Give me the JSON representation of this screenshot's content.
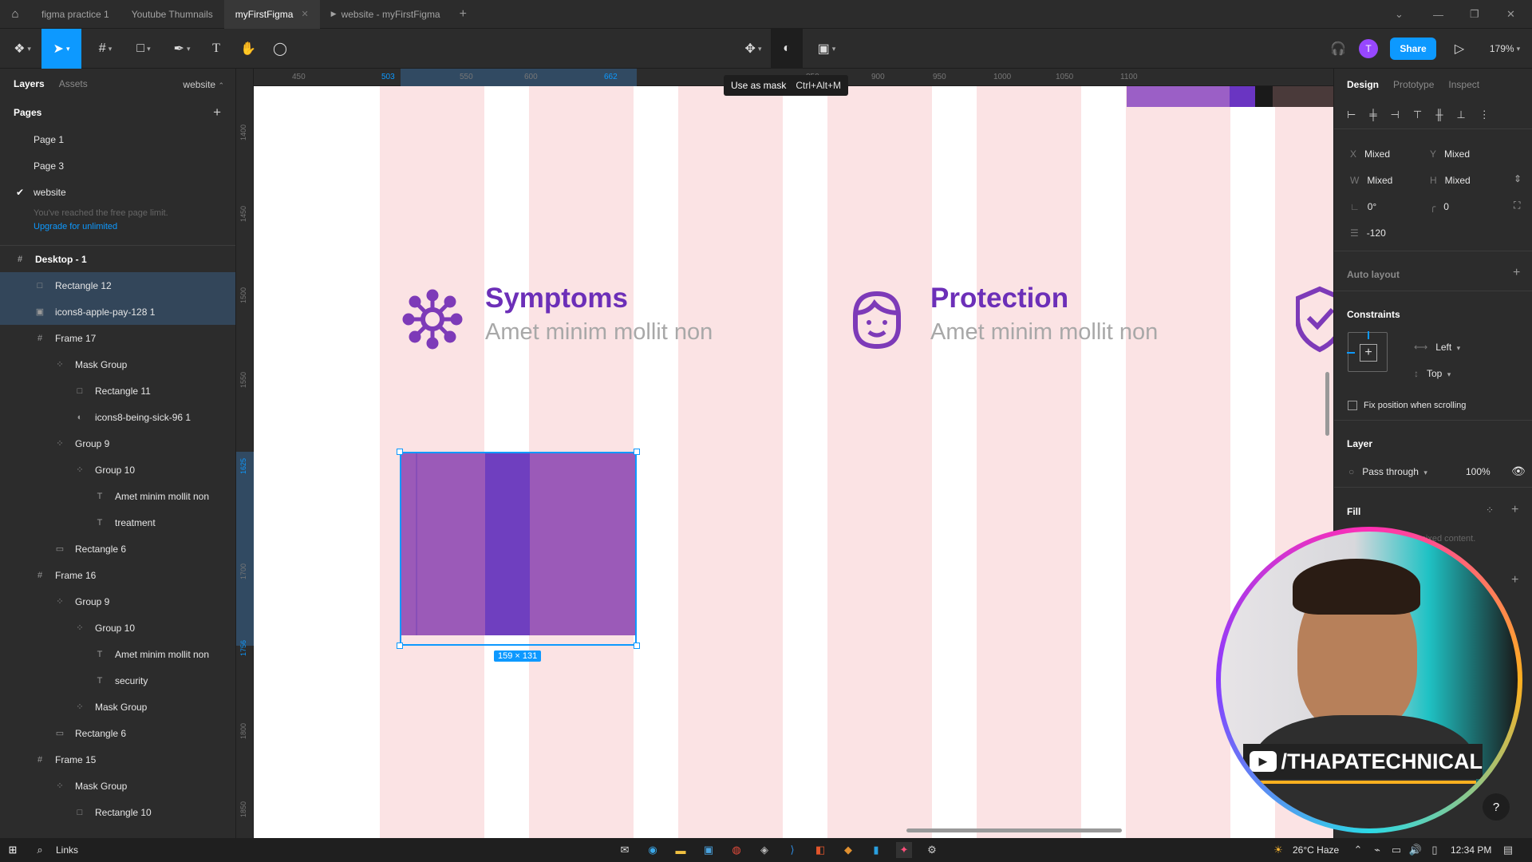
{
  "tabs": [
    {
      "label": "figma practice 1"
    },
    {
      "label": "Youtube Thumnails"
    },
    {
      "label": "myFirstFigma"
    },
    {
      "label": "website - myFirstFigma"
    }
  ],
  "toolbar": {
    "share_label": "Share",
    "avatar_initial": "T",
    "zoom": "179%",
    "tooltip_label": "Use as mask",
    "tooltip_shortcut": "Ctrl+Alt+M"
  },
  "left": {
    "tab_layers": "Layers",
    "tab_assets": "Assets",
    "page_selector": "website",
    "pages_title": "Pages",
    "pages": [
      "Page 1",
      "Page 3",
      "website"
    ],
    "limit_note": "You've reached the free page limit.",
    "upgrade_link": "Upgrade for unlimited",
    "layers": [
      {
        "name": "Desktop - 1",
        "icon": "frame-icon"
      },
      {
        "name": "Rectangle 12",
        "icon": "rectangle-icon"
      },
      {
        "name": "icons8-apple-pay-128 1",
        "icon": "image-icon"
      },
      {
        "name": "Frame 17",
        "icon": "frame-icon"
      },
      {
        "name": "Mask Group",
        "icon": "group-icon"
      },
      {
        "name": "Rectangle 11",
        "icon": "rectangle-icon"
      },
      {
        "name": "icons8-being-sick-96 1",
        "icon": "mask-icon"
      },
      {
        "name": "Group 9",
        "icon": "group-icon"
      },
      {
        "name": "Group 10",
        "icon": "group-icon"
      },
      {
        "name": "Amet minim mollit non",
        "icon": "text-icon"
      },
      {
        "name": "treatment",
        "icon": "text-icon"
      },
      {
        "name": "Rectangle 6",
        "icon": "line-icon"
      },
      {
        "name": "Frame 16",
        "icon": "frame-icon"
      },
      {
        "name": "Group 9",
        "icon": "group-icon"
      },
      {
        "name": "Group 10",
        "icon": "group-icon"
      },
      {
        "name": "Amet minim mollit non",
        "icon": "text-icon"
      },
      {
        "name": "security",
        "icon": "text-icon"
      },
      {
        "name": "Mask Group",
        "icon": "group-icon"
      },
      {
        "name": "Rectangle 6",
        "icon": "line-icon"
      },
      {
        "name": "Frame 15",
        "icon": "frame-icon"
      },
      {
        "name": "Mask Group",
        "icon": "group-icon"
      },
      {
        "name": "Rectangle 10",
        "icon": "rectangle-icon"
      }
    ]
  },
  "canvas": {
    "ruler_top": [
      "450",
      "503",
      "550",
      "600",
      "662",
      "850",
      "900",
      "950",
      "1000",
      "1050",
      "1100"
    ],
    "ruler_left": [
      "1400",
      "1450",
      "1500",
      "1550",
      "1625",
      "1700",
      "1756",
      "1800",
      "1850"
    ],
    "feature1_title": "Symptoms",
    "feature1_sub": "Amet minim mollit non",
    "feature2_title": "Protection",
    "feature2_sub": "Amet minim mollit non",
    "selection_size": "159 × 131",
    "brand_purple": "#6c2fb8"
  },
  "right": {
    "tab_design": "Design",
    "tab_prototype": "Prototype",
    "tab_inspect": "Inspect",
    "x_label": "X",
    "x_value": "Mixed",
    "y_label": "Y",
    "y_value": "Mixed",
    "w_label": "W",
    "w_value": "Mixed",
    "h_label": "H",
    "h_value": "Mixed",
    "rotation": "0°",
    "radius": "0",
    "spacing": "-120",
    "auto_layout": "Auto layout",
    "constraints": "Constraints",
    "constraint_h": "Left",
    "constraint_v": "Top",
    "fix_position": "Fix position when scrolling",
    "layer_title": "Layer",
    "blend_mode": "Pass through",
    "opacity": "100%",
    "fill_title": "Fill",
    "fill_note": "Click + to replace mixed content."
  },
  "webcam": {
    "channel": "/THAPATECHNICAL"
  },
  "taskbar": {
    "links": "Links",
    "weather": "26°C  Haze",
    "time": "12:34 PM"
  }
}
